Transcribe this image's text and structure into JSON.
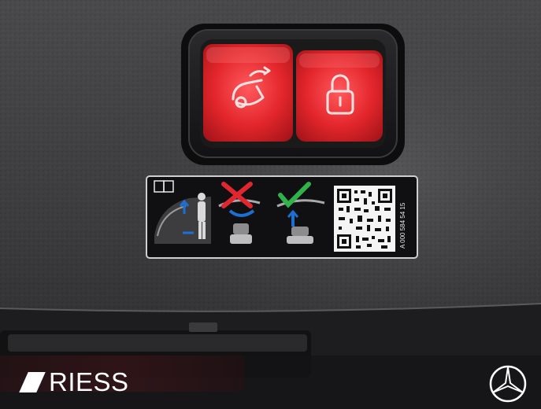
{
  "scene": "close-up of car tailgate trim panel with two illuminated red buttons and a warning sticker",
  "buttons": [
    {
      "icon": "tailgate-open-icon",
      "color": "#e3262b"
    },
    {
      "icon": "lock-icon",
      "color": "#e3262b"
    }
  ],
  "sticker": {
    "part_number": "A 000 584 54 15",
    "panels": [
      "manual-book-icon",
      "person-closing-tailgate-icon",
      "wrong-x-icon",
      "correct-check-icon",
      "qr-code"
    ],
    "colors": {
      "cross": "#e0262f",
      "check": "#2fb24a",
      "arrow": "#1d6fd1"
    }
  },
  "watermark": {
    "brand": "RIESS",
    "logo": "three-pointed-star-icon"
  }
}
